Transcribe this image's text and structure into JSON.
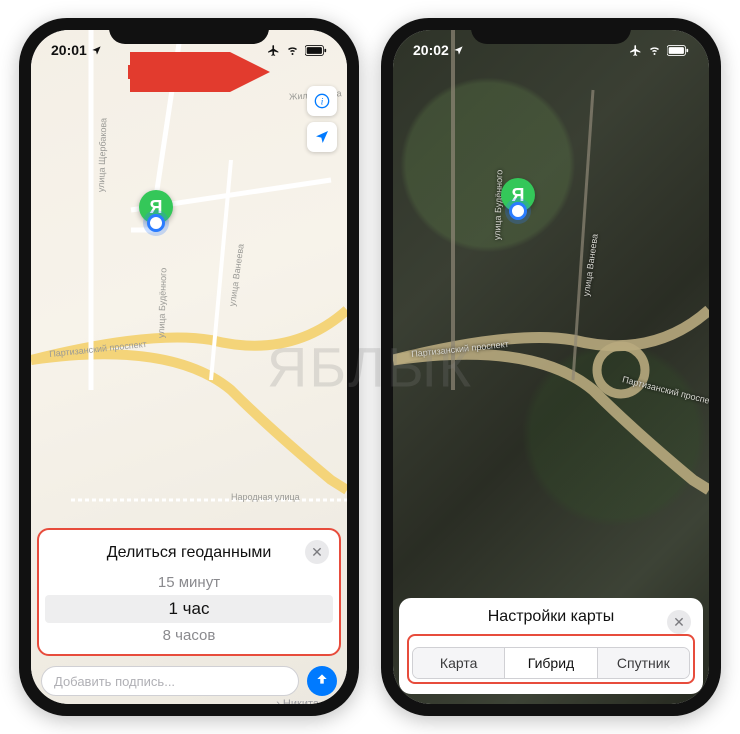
{
  "left": {
    "time": "20:01",
    "location_share": {
      "title": "Делиться геоданными",
      "options": [
        "15 минут",
        "1 час",
        "8 часов"
      ],
      "selected_index": 1
    },
    "compose": {
      "placeholder": "Добавить подпись...",
      "recipient": "Никита"
    },
    "pin_label": "Я",
    "streets": {
      "s1": "улица Щербакова",
      "s2": "улица Будённого",
      "s3": "улица Ванеева",
      "s4": "Партизанский проспект",
      "s5": "Народная улица",
      "s6": "Жилуновича"
    }
  },
  "right": {
    "time": "20:02",
    "map_settings": {
      "title": "Настройки карты",
      "options": [
        "Карта",
        "Гибрид",
        "Спутник"
      ],
      "selected_index": 1
    },
    "pin_label": "Я",
    "streets": {
      "s1": "улица Будённого",
      "s2": "улица Ванеева",
      "s3": "Партизанский проспект"
    }
  },
  "watermark": "ЯБЛЫК",
  "colors": {
    "accent": "#007aff",
    "highlight": "#e74c3c",
    "pin": "#34c759"
  }
}
